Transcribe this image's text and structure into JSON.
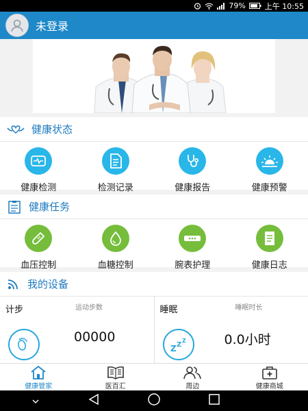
{
  "status_bar": {
    "battery": "79%",
    "time": "上午 10:55"
  },
  "header": {
    "title": "未登录"
  },
  "health_status": {
    "title": "健康状态",
    "items": [
      {
        "label": "健康检测",
        "icon": "monitor-pulse-icon"
      },
      {
        "label": "检测记录",
        "icon": "document-icon"
      },
      {
        "label": "健康报告",
        "icon": "stethoscope-icon"
      },
      {
        "label": "健康预警",
        "icon": "sunrise-alert-icon"
      }
    ]
  },
  "health_tasks": {
    "title": "健康任务",
    "items": [
      {
        "label": "血压控制",
        "icon": "thermometer-icon"
      },
      {
        "label": "血糖控制",
        "icon": "droplet-icon"
      },
      {
        "label": "腕表护理",
        "icon": "wristband-icon"
      },
      {
        "label": "健康日志",
        "icon": "notebook-icon"
      }
    ]
  },
  "devices": {
    "title": "我的设备",
    "steps": {
      "title": "计步",
      "subtitle": "运动步数",
      "value": "00000"
    },
    "sleep": {
      "title": "睡眠",
      "subtitle": "睡眠时长",
      "value": "0.0小时"
    }
  },
  "bottom_nav": [
    {
      "label": "健康管家",
      "active": true
    },
    {
      "label": "医百汇",
      "active": false
    },
    {
      "label": "周边",
      "active": false
    },
    {
      "label": "健康商城",
      "active": false
    }
  ],
  "colors": {
    "primary": "#1e88c8",
    "icon_blue": "#29b6e8",
    "icon_green": "#75bd3b"
  }
}
